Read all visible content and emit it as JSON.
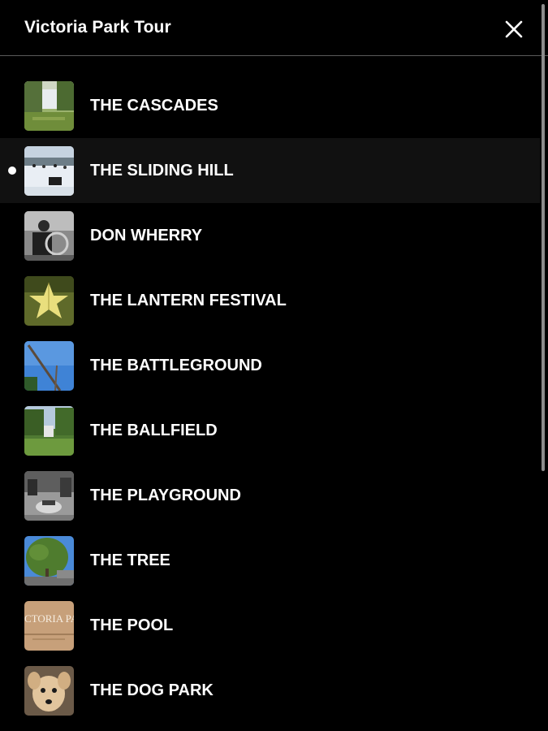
{
  "header": {
    "title": "Victoria Park Tour",
    "close_icon": "close-icon"
  },
  "colors": {
    "background": "#000000",
    "active_row": "#111111",
    "divider": "#5a5a5a",
    "text": "#ffffff"
  },
  "stops": {
    "active_index": 1,
    "items": [
      {
        "label": "THE CASCADES",
        "thumbnail": "cascades-photo"
      },
      {
        "label": "THE SLIDING HILL",
        "thumbnail": "sliding-hill-photo"
      },
      {
        "label": "DON WHERRY",
        "thumbnail": "don-wherry-photo"
      },
      {
        "label": "THE LANTERN FESTIVAL",
        "thumbnail": "lantern-festival-photo"
      },
      {
        "label": "THE BATTLEGROUND",
        "thumbnail": "battleground-photo"
      },
      {
        "label": "THE BALLFIELD",
        "thumbnail": "ballfield-photo"
      },
      {
        "label": "THE PLAYGROUND",
        "thumbnail": "playground-photo"
      },
      {
        "label": "THE TREE",
        "thumbnail": "tree-photo"
      },
      {
        "label": "THE POOL",
        "thumbnail": "pool-sign-photo",
        "thumbnail_text": "CTORIA PA"
      },
      {
        "label": "THE DOG PARK",
        "thumbnail": "dog-photo"
      }
    ]
  }
}
